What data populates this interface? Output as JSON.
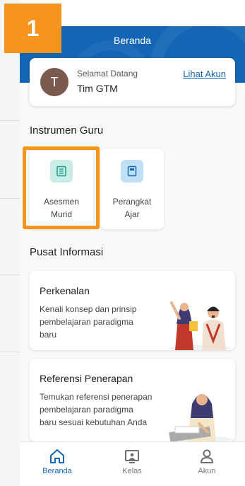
{
  "step_badge": "1",
  "header": {
    "title": "Beranda"
  },
  "welcome": {
    "avatar_initial": "T",
    "greeting": "Selamat Datang",
    "user_name": "Tim GTM",
    "view_account": "Lihat Akun"
  },
  "instrumen": {
    "title": "Instrumen Guru",
    "items": [
      {
        "label_line1": "Asesmen",
        "label_line2": "Murid",
        "icon": "clipboard-list-icon",
        "color": "#c8ece6"
      },
      {
        "label_line1": "Perangkat",
        "label_line2": "Ajar",
        "icon": "book-icon",
        "color": "#bfe0f5"
      }
    ]
  },
  "pusat": {
    "title": "Pusat Informasi",
    "cards": [
      {
        "title": "Perkenalan",
        "desc_line1": "Kenali konsep dan prinsip",
        "desc_line2": "pembelajaran paradigma",
        "desc_line3": "baru"
      },
      {
        "title": "Referensi Penerapan",
        "desc_line1": "Temukan referensi penerapan",
        "desc_line2": "pembelajaran paradigma",
        "desc_line3": "baru sesuai kebutuhan Anda"
      }
    ]
  },
  "nav": {
    "items": [
      {
        "label": "Beranda",
        "active": true
      },
      {
        "label": "Kelas",
        "active": false
      },
      {
        "label": "Akun",
        "active": false
      }
    ]
  },
  "colors": {
    "primary": "#1366b5",
    "highlight": "#f7941d"
  }
}
